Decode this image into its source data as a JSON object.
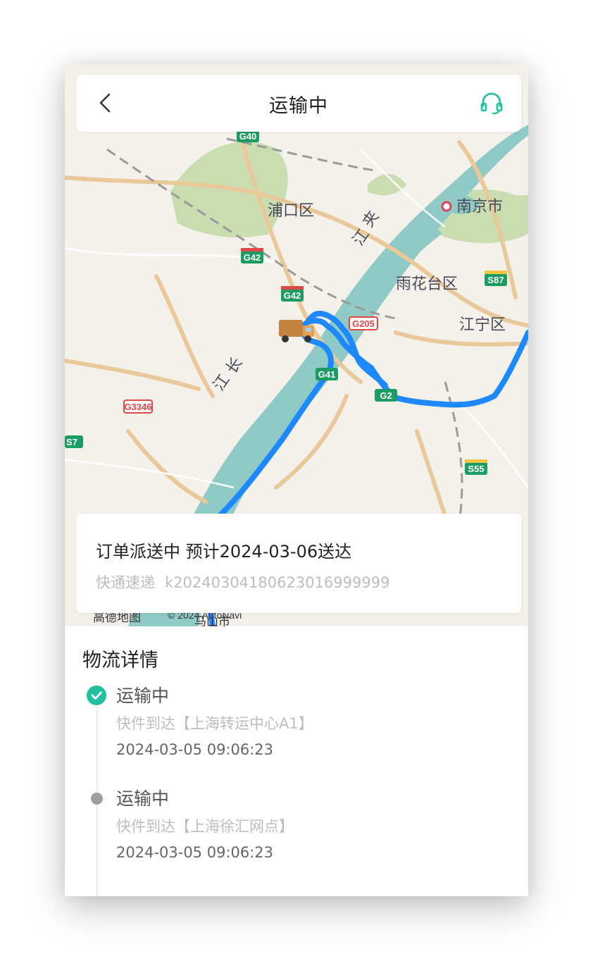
{
  "header": {
    "title": "运输中",
    "back_icon": "chevron-left-icon",
    "service_icon": "headset-icon"
  },
  "map": {
    "labels": {
      "pukou": "浦口区",
      "nanjing": "南京市",
      "yuhuatai": "雨花台区",
      "jiangning": "江宁区",
      "jia": "夹",
      "jiang_river": "江",
      "chang": "长",
      "jiang2": "江"
    },
    "shields": {
      "g40": "G40",
      "g42a": "G42",
      "g42b": "G42",
      "g205": "G205",
      "s87": "S87",
      "g3346": "G3346",
      "s7": "S7",
      "s55": "S55",
      "g4x": "G41",
      "g2x": "G2"
    },
    "attribution": "高德地图",
    "copyright": "© 2024 AutoNavi",
    "bottom_place": "马山市",
    "colors": {
      "route": "#1e88ff",
      "river": "#8fcac6",
      "green": "#c9ddb0",
      "road": "#e9c99a"
    }
  },
  "status_card": {
    "status": "订单派送中 预计2024-03-06送达",
    "carrier": "快通速递",
    "tracking_no": "k20240304180623016999999"
  },
  "details": {
    "title": "物流详情",
    "events": [
      {
        "status": "运输中",
        "desc": "快件到达【上海转运中心A1】",
        "time": "2024-03-05 09:06:23",
        "current": true
      },
      {
        "status": "运输中",
        "desc": "快件到达【上海徐汇网点】",
        "time": "2024-03-05 09:06:23",
        "current": false
      }
    ],
    "accent": "#1fbfa0"
  }
}
